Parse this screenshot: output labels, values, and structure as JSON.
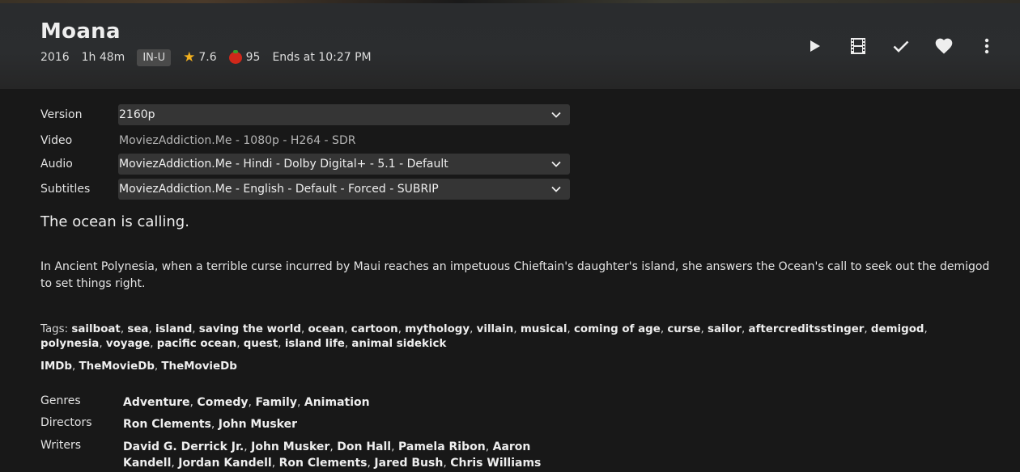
{
  "header": {
    "title": "Moana",
    "year": "2016",
    "runtime": "1h 48m",
    "rating_badge": "IN-U",
    "community_rating": "7.6",
    "critic_rating": "95",
    "ends_at": "Ends at 10:27 PM",
    "actions": [
      {
        "name": "play-button",
        "icon": "play-icon"
      },
      {
        "name": "trailer-button",
        "icon": "film-icon"
      },
      {
        "name": "mark-played-button",
        "icon": "check-icon"
      },
      {
        "name": "favorite-button",
        "icon": "heart-icon"
      },
      {
        "name": "more-button",
        "icon": "more-vert-icon"
      }
    ]
  },
  "media": {
    "version_label": "Version",
    "version_value": "2160p",
    "video_label": "Video",
    "video_value": "MoviezAddiction.Me - 1080p - H264 - SDR",
    "audio_label": "Audio",
    "audio_value": "MoviezAddiction.Me - Hindi - Dolby Digital+ - 5.1 - Default",
    "subtitles_label": "Subtitles",
    "subtitles_value": "MoviezAddiction.Me - English - Default - Forced - SUBRIP"
  },
  "tagline": "The ocean is calling.",
  "overview": "In Ancient Polynesia, when a terrible curse incurred by Maui reaches an impetuous Chieftain's daughter's island, she answers the Ocean's call to seek out the demigod to set things right.",
  "tags_label": "Tags:",
  "tags": [
    "sailboat",
    "sea",
    "island",
    "saving the world",
    "ocean",
    "cartoon",
    "mythology",
    "villain",
    "musical",
    "coming of age",
    "curse",
    "sailor",
    "aftercreditsstinger",
    "demigod",
    "polynesia",
    "voyage",
    "pacific ocean",
    "quest",
    "island life",
    "animal sidekick"
  ],
  "external_links": [
    "IMDb",
    "TheMovieDb",
    "TheMovieDb"
  ],
  "details": {
    "genres_label": "Genres",
    "genres": [
      "Adventure",
      "Comedy",
      "Family",
      "Animation"
    ],
    "directors_label": "Directors",
    "directors": [
      "Ron Clements",
      "John Musker"
    ],
    "writers_label": "Writers",
    "writers": [
      "David G. Derrick Jr.",
      "John Musker",
      "Don Hall",
      "Pamela Ribon",
      "Aaron Kandell",
      "Jordan Kandell",
      "Ron Clements",
      "Jared Bush",
      "Chris Williams"
    ]
  },
  "colors": {
    "background": "#181818",
    "accent_star": "#f2b01e",
    "tomato": "#d0281a",
    "select_bg": "#353535"
  }
}
